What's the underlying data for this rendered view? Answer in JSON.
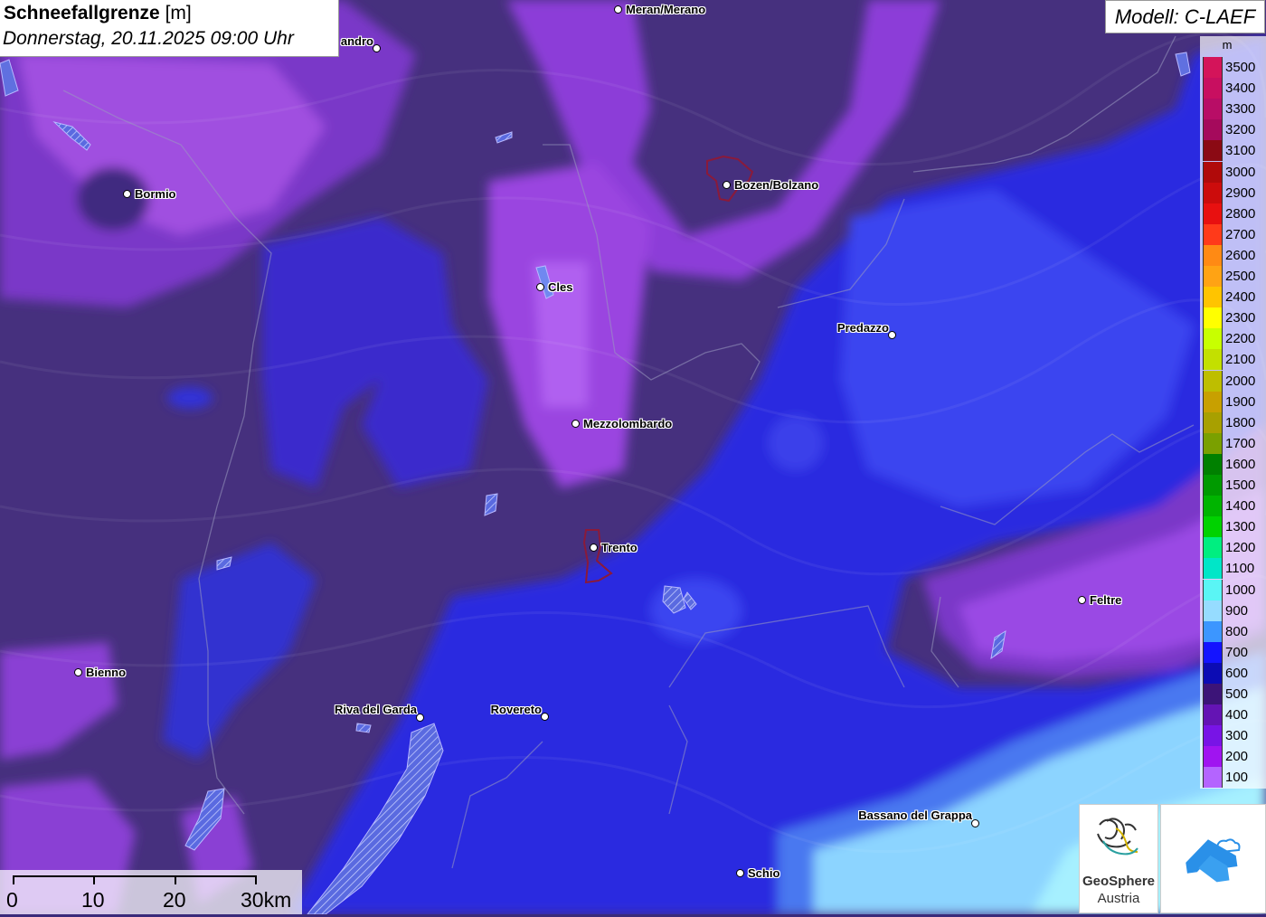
{
  "title": {
    "variable": "Schneefallgrenze",
    "unit": "[m]",
    "datetime": "Donnerstag, 20.11.2025 09:00 Uhr"
  },
  "model": "Modell: C-LAEF",
  "legend": {
    "unit": "m",
    "entries": [
      {
        "label": "3500",
        "color": "#d4145a"
      },
      {
        "label": "3400",
        "color": "#c80f60"
      },
      {
        "label": "3300",
        "color": "#b80d66"
      },
      {
        "label": "3200",
        "color": "#a50a5c"
      },
      {
        "label": "3100",
        "color": "#8b0a14"
      },
      {
        "label": "3000",
        "color": "#b00a0a"
      },
      {
        "label": "2900",
        "color": "#cc0c0c"
      },
      {
        "label": "2800",
        "color": "#e81010"
      },
      {
        "label": "2700",
        "color": "#ff3a1a"
      },
      {
        "label": "2600",
        "color": "#ff8a14"
      },
      {
        "label": "2500",
        "color": "#ffa314"
      },
      {
        "label": "2400",
        "color": "#ffc400"
      },
      {
        "label": "2300",
        "color": "#ffff00"
      },
      {
        "label": "2200",
        "color": "#c8ff00"
      },
      {
        "label": "2100",
        "color": "#c3e000"
      },
      {
        "label": "2000",
        "color": "#bebe00"
      },
      {
        "label": "1900",
        "color": "#c8a000"
      },
      {
        "label": "1800",
        "color": "#a8a000"
      },
      {
        "label": "1700",
        "color": "#7aa000"
      },
      {
        "label": "1600",
        "color": "#008000"
      },
      {
        "label": "1500",
        "color": "#009a00"
      },
      {
        "label": "1400",
        "color": "#00b400"
      },
      {
        "label": "1300",
        "color": "#00d200"
      },
      {
        "label": "1200",
        "color": "#00ee80"
      },
      {
        "label": "1100",
        "color": "#00e6c8"
      },
      {
        "label": "1000",
        "color": "#5af5f5"
      },
      {
        "label": "900",
        "color": "#96dcff"
      },
      {
        "label": "800",
        "color": "#3c96ff"
      },
      {
        "label": "700",
        "color": "#1414ff"
      },
      {
        "label": "600",
        "color": "#0c0cb4"
      },
      {
        "label": "500",
        "color": "#3c1478"
      },
      {
        "label": "400",
        "color": "#6414b4"
      },
      {
        "label": "300",
        "color": "#7814e6"
      },
      {
        "label": "200",
        "color": "#a014f0"
      },
      {
        "label": "100",
        "color": "#b464ff"
      }
    ]
  },
  "cities": [
    {
      "name": "Meran/Merano"
    },
    {
      "name": "andro"
    },
    {
      "name": "Bormio"
    },
    {
      "name": "Bozen/Bolzano"
    },
    {
      "name": "Cles"
    },
    {
      "name": "Predazzo"
    },
    {
      "name": "Mezzolombardo"
    },
    {
      "name": "Trento"
    },
    {
      "name": "Feltre"
    },
    {
      "name": "Bienno"
    },
    {
      "name": "Riva del Garda"
    },
    {
      "name": "Rovereto"
    },
    {
      "name": "Bassano del Grappa"
    },
    {
      "name": "Schio"
    }
  ],
  "scale_bar": {
    "labels": [
      "0",
      "10",
      "20",
      "30km"
    ]
  },
  "logos": {
    "geosphere_line1": "GeoSphere",
    "geosphere_line2": "Austria"
  },
  "colors": {
    "dark_purple": "#3f2a80",
    "mid_purple": "#5a2aa8",
    "violet": "#8a3ad0",
    "blue": "#2a2ad8",
    "light_blue": "#4a70f0",
    "cyan": "#8ad8ff"
  }
}
